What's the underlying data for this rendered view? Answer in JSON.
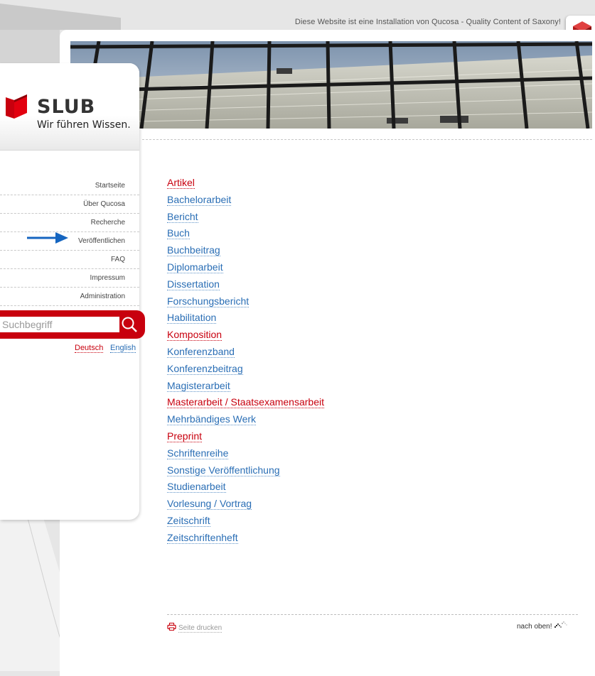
{
  "header": {
    "top_note": "Diese Website ist eine Installation von Qucosa - Quality Content of Saxony!"
  },
  "logo": {
    "title": "SLUB",
    "slogan": "Wir führen Wissen."
  },
  "nav": {
    "items": [
      {
        "label": "Startseite"
      },
      {
        "label": "Über Qucosa"
      },
      {
        "label": "Recherche"
      },
      {
        "label": "Veröffentlichen"
      },
      {
        "label": "FAQ"
      },
      {
        "label": "Impressum"
      },
      {
        "label": "Administration"
      }
    ]
  },
  "search": {
    "placeholder": "Suchbegriff"
  },
  "languages": {
    "de": "Deutsch",
    "en": "English"
  },
  "doc_types": [
    {
      "label": "Artikel",
      "color": "red"
    },
    {
      "label": "Bachelorarbeit",
      "color": "blue"
    },
    {
      "label": "Bericht",
      "color": "blue"
    },
    {
      "label": "Buch",
      "color": "blue"
    },
    {
      "label": "Buchbeitrag",
      "color": "blue"
    },
    {
      "label": "Diplomarbeit",
      "color": "blue"
    },
    {
      "label": "Dissertation",
      "color": "blue"
    },
    {
      "label": "Forschungsbericht",
      "color": "blue"
    },
    {
      "label": "Habilitation",
      "color": "blue"
    },
    {
      "label": "Komposition",
      "color": "red"
    },
    {
      "label": "Konferenzband",
      "color": "blue"
    },
    {
      "label": "Konferenzbeitrag",
      "color": "blue"
    },
    {
      "label": "Magisterarbeit",
      "color": "blue"
    },
    {
      "label": "Masterarbeit / Staatsexamensarbeit",
      "color": "red"
    },
    {
      "label": "Mehrbändiges Werk",
      "color": "blue"
    },
    {
      "label": "Preprint",
      "color": "red"
    },
    {
      "label": "Schriftenreihe",
      "color": "blue"
    },
    {
      "label": "Sonstige Veröffentlichung",
      "color": "blue"
    },
    {
      "label": "Studienarbeit",
      "color": "blue"
    },
    {
      "label": "Vorlesung / Vortrag",
      "color": "blue"
    },
    {
      "label": "Zeitschrift",
      "color": "blue"
    },
    {
      "label": "Zeitschriftenheft",
      "color": "blue"
    }
  ],
  "footer": {
    "print_label": "Seite drucken",
    "top_label": "nach oben!"
  },
  "colors": {
    "brand_red": "#c8000e",
    "link_blue": "#2a6eb5",
    "arrow_blue": "#1565c0"
  }
}
